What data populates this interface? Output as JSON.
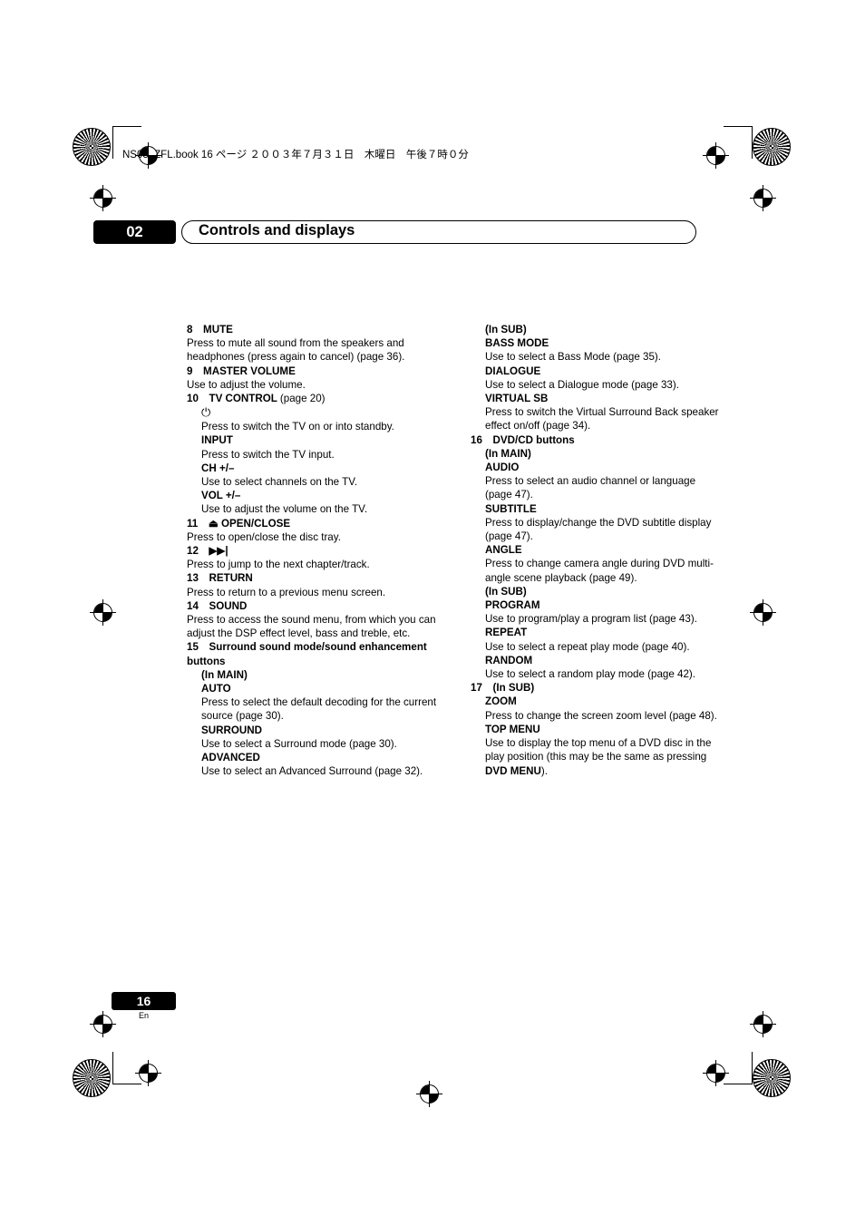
{
  "header": {
    "book_line": "NS03_ZFL.book 16 ページ ２００３年７月３１日　木曜日　午後７時０分",
    "chapter_number": "02",
    "chapter_title": "Controls and displays"
  },
  "footer": {
    "page_number": "16",
    "language_code": "En"
  },
  "left_column": [
    {
      "kind": "item",
      "num": "8",
      "title": "MUTE",
      "page": "",
      "desc": "Press to mute all sound from the speakers and headphones (press again to cancel) (page 36)."
    },
    {
      "kind": "item",
      "num": "9",
      "title": "MASTER VOLUME",
      "page": "",
      "desc": "Use to adjust the volume."
    },
    {
      "kind": "item",
      "num": "10",
      "title": "TV CONTROL",
      "page": "(page 20)",
      "desc": ""
    },
    {
      "kind": "glyph",
      "glyph": "⏻",
      "desc": "Press to switch the TV on or into standby."
    },
    {
      "kind": "sub",
      "title": "INPUT",
      "desc": "Press to switch the TV input."
    },
    {
      "kind": "sub",
      "title": "CH +/–",
      "desc": "Use to select channels on the TV."
    },
    {
      "kind": "sub",
      "title": "VOL +/–",
      "desc": "Use to adjust the volume on the TV."
    },
    {
      "kind": "item",
      "num": "11",
      "title": "⏏ OPEN/CLOSE",
      "page": "",
      "desc": "Press to open/close the disc tray."
    },
    {
      "kind": "item",
      "num": "12",
      "title": "▶▶|",
      "page": "",
      "desc": "Press to jump to the next chapter/track."
    },
    {
      "kind": "item",
      "num": "13",
      "title": "RETURN",
      "page": "",
      "desc": "Press to return to a previous menu screen."
    },
    {
      "kind": "item",
      "num": "14",
      "title": "SOUND",
      "page": "",
      "desc": "Press to access the sound menu, from which you can adjust the DSP effect level, bass and treble, etc."
    },
    {
      "kind": "item",
      "num": "15",
      "title": "Surround sound mode/sound enhancement buttons",
      "page": "",
      "desc": ""
    },
    {
      "kind": "group",
      "title": "(In MAIN)"
    },
    {
      "kind": "sub_tight",
      "title": "AUTO",
      "desc": "Press to select the default decoding for the current source (page 30)."
    },
    {
      "kind": "sub",
      "title": "SURROUND",
      "desc": "Use to select a Surround mode (page 30)."
    },
    {
      "kind": "sub",
      "title": "ADVANCED",
      "desc": "Use to select an Advanced Surround (page 32)."
    }
  ],
  "right_column": [
    {
      "kind": "group_first",
      "title": "(In SUB)"
    },
    {
      "kind": "sub_tight",
      "title": "BASS MODE",
      "desc": "Use to select a Bass Mode (page 35)."
    },
    {
      "kind": "sub",
      "title": "DIALOGUE",
      "desc": "Use to select a Dialogue mode (page 33)."
    },
    {
      "kind": "sub",
      "title": "VIRTUAL SB",
      "desc": "Press to switch the Virtual Surround Back speaker effect on/off (page 34)."
    },
    {
      "kind": "item",
      "num": "16",
      "title": "DVD/CD buttons",
      "page": "",
      "desc": ""
    },
    {
      "kind": "group",
      "title": "(In MAIN)"
    },
    {
      "kind": "sub_tight",
      "title": "AUDIO",
      "desc": "Press to select an audio channel or language (page 47)."
    },
    {
      "kind": "sub",
      "title": "SUBTITLE",
      "desc": "Press to display/change the DVD subtitle display (page 47)."
    },
    {
      "kind": "sub",
      "title": "ANGLE",
      "desc": "Press to change camera angle during DVD multi-angle scene playback (page 49)."
    },
    {
      "kind": "group",
      "title": "(In SUB)"
    },
    {
      "kind": "sub_tight",
      "title": "PROGRAM",
      "desc": "Use to program/play a program list (page 43)."
    },
    {
      "kind": "sub",
      "title": "REPEAT",
      "desc": "Use to select a repeat play mode (page 40)."
    },
    {
      "kind": "sub",
      "title": "RANDOM",
      "desc": "Use to select a random play mode (page 42)."
    },
    {
      "kind": "item",
      "num": "17",
      "title": "(In SUB)",
      "page": "",
      "desc": ""
    },
    {
      "kind": "sub",
      "title": "ZOOM",
      "desc": "Press to change the screen zoom level (page 48)."
    },
    {
      "kind": "sub_bold_inline",
      "title": "TOP MENU",
      "desc_pre": "Use to display the top menu of a DVD disc in the play position (this may be the same as pressing ",
      "desc_bold": "DVD MENU",
      "desc_post": ")."
    }
  ]
}
